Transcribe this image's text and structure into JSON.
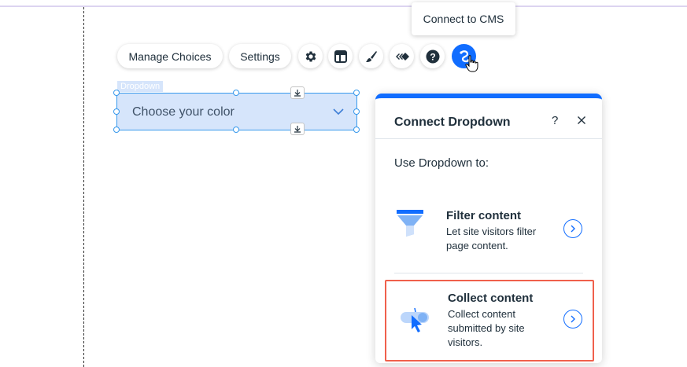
{
  "tooltip": {
    "text": "Connect to CMS"
  },
  "toolbar": {
    "manage_choices": "Manage Choices",
    "settings": "Settings",
    "icons": [
      "gear-icon",
      "layout-icon",
      "brush-icon",
      "animation-icon",
      "help-icon",
      "connect-cms-icon"
    ]
  },
  "element": {
    "tag": "Dropdown",
    "placeholder": "Choose your color"
  },
  "panel": {
    "title": "Connect Dropdown",
    "help": "?",
    "subtitle": "Use Dropdown to:",
    "options": [
      {
        "title": "Filter content",
        "desc_lines": [
          "Let site visitors filter",
          "page content."
        ],
        "icon": "funnel-icon"
      },
      {
        "title": "Collect content",
        "desc_lines": [
          "Collect content",
          "submitted by site",
          "visitors."
        ],
        "icon": "toggle-cursor-icon",
        "highlighted": true
      }
    ]
  },
  "colors": {
    "accent": "#116dff",
    "selection": "#d6e5fb",
    "highlight": "#f0604c"
  }
}
